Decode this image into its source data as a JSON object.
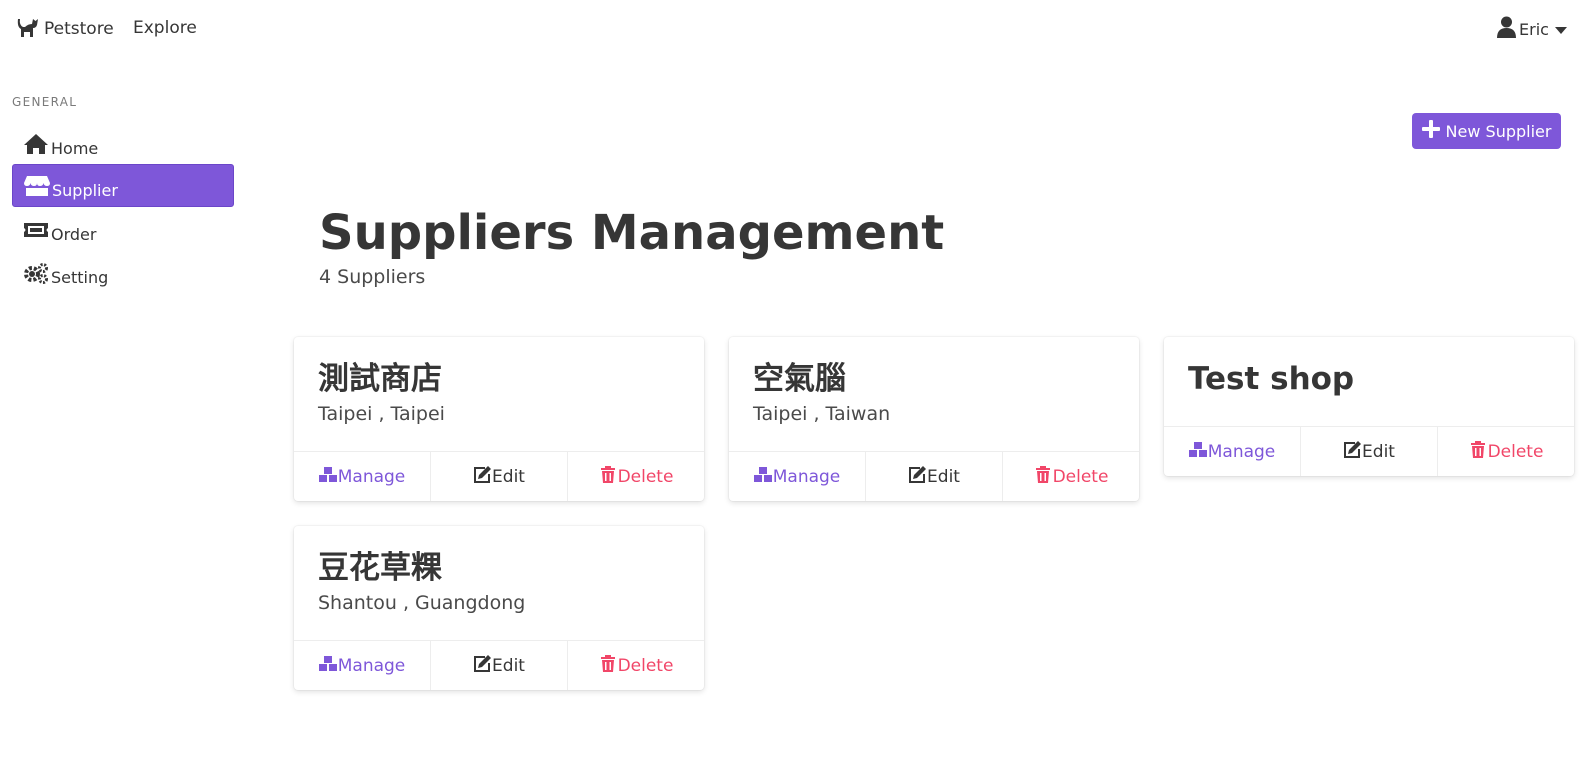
{
  "navbar": {
    "brand": "Petstore",
    "explore": "Explore",
    "user": "Eric"
  },
  "sidebar": {
    "label": "GENERAL",
    "items": [
      {
        "label": "Home",
        "icon": "home-icon"
      },
      {
        "label": "Supplier",
        "icon": "store-icon",
        "active": true
      },
      {
        "label": "Order",
        "icon": "ticket-icon"
      },
      {
        "label": "Setting",
        "icon": "gears-icon"
      }
    ]
  },
  "header": {
    "new_button": "New Supplier",
    "title": "Suppliers Management",
    "subtitle": "4 Suppliers"
  },
  "cards": [
    {
      "name": "測試商店",
      "location": "Taipei , Taipei"
    },
    {
      "name": "空氣腦",
      "location": "Taipei , Taiwan"
    },
    {
      "name": "Test shop",
      "location": ""
    },
    {
      "name": "豆花草粿",
      "location": "Shantou , Guangdong"
    }
  ],
  "actions": {
    "manage": "Manage",
    "edit": "Edit",
    "delete": "Delete"
  },
  "colors": {
    "accent": "#7e57d9",
    "danger": "#f14668",
    "text": "#363636"
  }
}
